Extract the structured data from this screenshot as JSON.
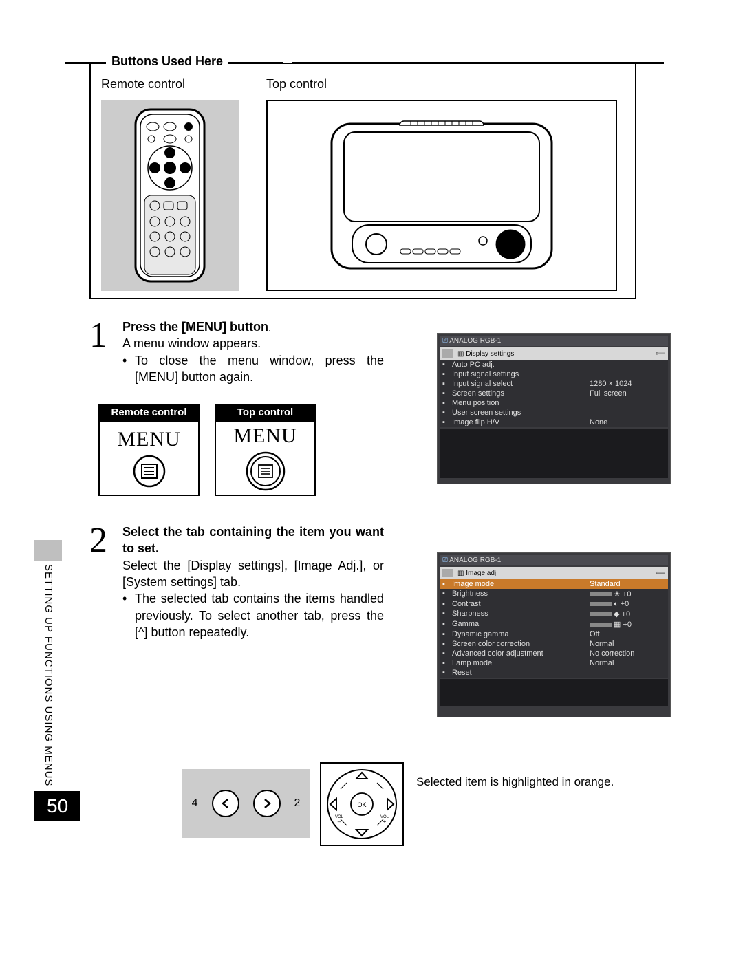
{
  "fieldset": {
    "legend": "Buttons Used Here",
    "remote_label": "Remote control",
    "top_label": "Top control"
  },
  "step1": {
    "num": "1",
    "heading": "Press the [MENU] button",
    "period": ".",
    "line1": "A menu window appears.",
    "bullet": "To close the menu window, press the [MENU] button again."
  },
  "menu_buttons": {
    "remote_label": "Remote control",
    "top_label": "Top control",
    "menu_word": "MENU"
  },
  "step2": {
    "num": "2",
    "heading": "Select the tab containing the item you want to set.",
    "line1": "Select the [Display settings], [Image Adj.], or [System settings] tab.",
    "bullet": "The selected tab contains the items handled previously. To select another tab, press the [^] button repeatedly."
  },
  "arrow_remote": {
    "left_num": "4",
    "right_num": "2"
  },
  "dpad": {
    "ok": "OK",
    "vol_minus": "VOL\n–",
    "vol_plus": "VOL\n+"
  },
  "caption_selected": "Selected item is highlighted in orange.",
  "sidebar_text": "SETTING UP FUNCTIONS USING MENUS",
  "page_number": "50",
  "screenshot1": {
    "title": "ANALOG RGB-1",
    "tab": "Display settings",
    "rows": [
      {
        "label": "Auto PC adj.",
        "val": ""
      },
      {
        "label": "Input signal settings",
        "val": ""
      },
      {
        "label": "Input signal select",
        "val": "1280 × 1024"
      },
      {
        "label": "Screen settings",
        "val": "Full screen"
      },
      {
        "label": "Menu position",
        "val": ""
      },
      {
        "label": "User screen settings",
        "val": ""
      },
      {
        "label": "Image flip H/V",
        "val": "None"
      }
    ]
  },
  "screenshot2": {
    "title": "ANALOG RGB-1",
    "tab": "Image adj.",
    "rows": [
      {
        "label": "Image mode",
        "val": "Standard",
        "orange": true
      },
      {
        "label": "Brightness",
        "val": "+0",
        "bar": true,
        "sym": "☀"
      },
      {
        "label": "Contrast",
        "val": "+0",
        "bar": true,
        "sym": "◐"
      },
      {
        "label": "Sharpness",
        "val": "+0",
        "bar": true,
        "sym": "◆"
      },
      {
        "label": "Gamma",
        "val": "+0",
        "bar": true,
        "sym": "▦"
      },
      {
        "label": "Dynamic gamma",
        "val": "Off"
      },
      {
        "label": "Screen color correction",
        "val": "Normal"
      },
      {
        "label": "Advanced color adjustment",
        "val": "No correction"
      },
      {
        "label": "Lamp mode",
        "val": "Normal"
      },
      {
        "label": "Reset",
        "val": ""
      }
    ]
  }
}
